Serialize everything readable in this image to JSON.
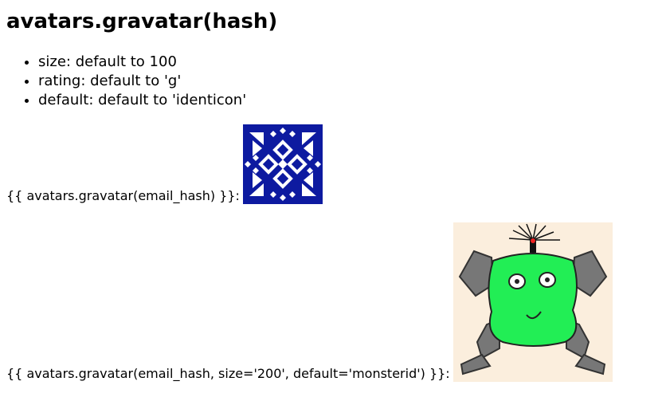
{
  "heading": "avatars.gravatar(hash)",
  "options": [
    "size: default to 100",
    "rating: default to 'g'",
    "default: default to 'identicon'"
  ],
  "examples": [
    {
      "code": "{{ avatars.gravatar(email_hash) }}:",
      "avatar_kind": "identicon",
      "colors": {
        "bg": "#0d1aa0",
        "fg": "#ffffff"
      }
    },
    {
      "code": "{{ avatars.gravatar(email_hash, size='200', default='monsterid') }}:",
      "avatar_kind": "monsterid",
      "colors": {
        "bg": "#fbeedd",
        "body": "#22ee55",
        "limb": "#777777"
      }
    }
  ]
}
